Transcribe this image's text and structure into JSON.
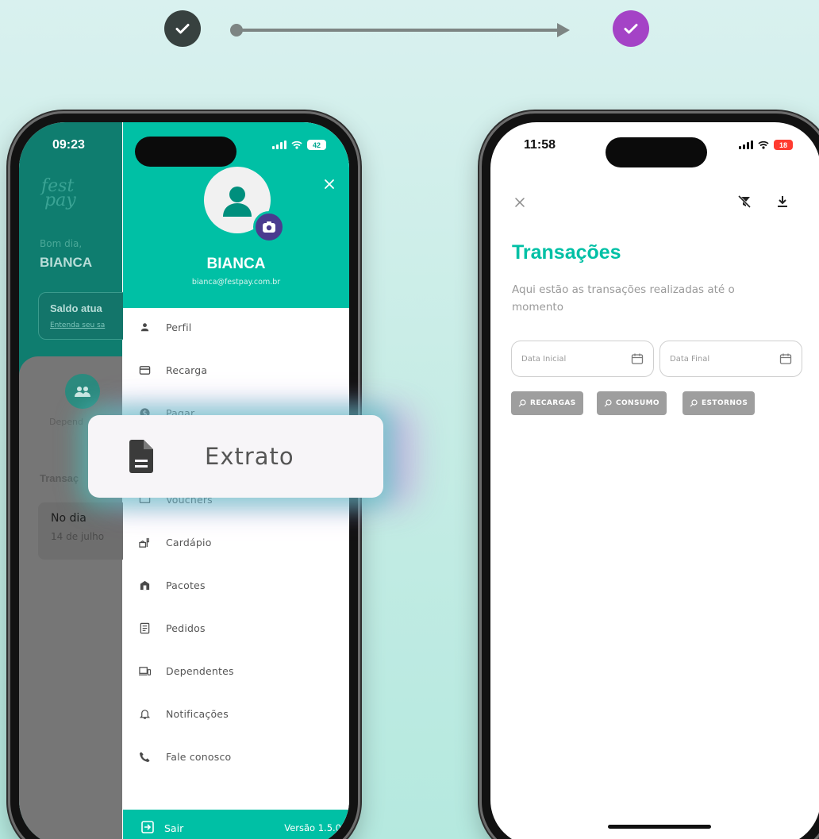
{
  "flow": {
    "start_step_color": "#37413f",
    "end_step_color": "#a443c6",
    "arrow_color": "#7d8583"
  },
  "left_phone": {
    "status": {
      "time": "09:23",
      "battery": "42"
    },
    "background": {
      "logo_line1": "fest",
      "logo_line2": "pay",
      "greeting": "Bom dia,",
      "name": "BIANCA",
      "balance_label": "Saldo atua",
      "balance_link": "Entenda seu sa",
      "dependents_label": "Depend",
      "transactions_label": "Transaç",
      "day_label": "No dia",
      "date_value": "14 de julho"
    },
    "drawer": {
      "user_name": "BIANCA",
      "user_email": "bianca@festpay.com.br",
      "menu": [
        {
          "icon": "person-icon",
          "label": "Perfil"
        },
        {
          "icon": "card-icon",
          "label": "Recarga"
        },
        {
          "icon": "dollar-icon",
          "label": "Pagar"
        },
        {
          "icon": "ticket-icon",
          "label": "Vouchers"
        },
        {
          "icon": "menu-food-icon",
          "label": "Cardápio"
        },
        {
          "icon": "package-icon",
          "label": "Pacotes"
        },
        {
          "icon": "orders-icon",
          "label": "Pedidos"
        },
        {
          "icon": "devices-icon",
          "label": "Dependentes"
        },
        {
          "icon": "bell-icon",
          "label": "Notificações"
        },
        {
          "icon": "phone-icon",
          "label": "Fale conosco"
        }
      ],
      "logout_label": "Sair",
      "version": "Versão 1.5.0"
    },
    "accent_color": "#00c0a5"
  },
  "highlight": {
    "label": "Extrato",
    "icon": "document-icon"
  },
  "right_phone": {
    "status": {
      "time": "11:58",
      "battery": "18"
    },
    "title": "Transações",
    "description": "Aqui estão as transações realizadas até o momento",
    "start_date_placeholder": "Data Inicial",
    "end_date_placeholder": "Data Final",
    "filters": [
      "RECARGAS",
      "CONSUMO",
      "ESTORNOS"
    ],
    "accent_color": "#00c0a5"
  }
}
